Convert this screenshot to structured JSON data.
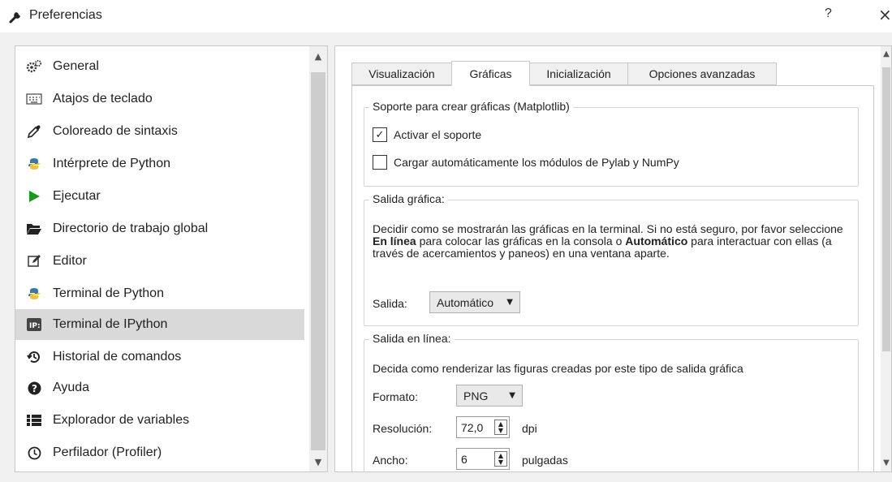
{
  "window": {
    "title": "Preferencias",
    "icon": "wrench-icon",
    "help_label": "?",
    "close_label": "×"
  },
  "sidebar": {
    "items": [
      {
        "label": "General",
        "icon": "gears-icon"
      },
      {
        "label": "Atajos de teclado",
        "icon": "keyboard-icon"
      },
      {
        "label": "Coloreado de sintaxis",
        "icon": "eyedropper-icon"
      },
      {
        "label": "Intérprete de Python",
        "icon": "python-icon"
      },
      {
        "label": "Ejecutar",
        "icon": "play-icon"
      },
      {
        "label": "Directorio de trabajo global",
        "icon": "folder-icon"
      },
      {
        "label": "Editor",
        "icon": "edit-icon"
      },
      {
        "label": "Terminal de Python",
        "icon": "python-icon"
      },
      {
        "label": "Terminal de IPython",
        "icon": "ipython-icon"
      },
      {
        "label": "Historial de comandos",
        "icon": "history-icon"
      },
      {
        "label": "Ayuda",
        "icon": "question-circle-icon"
      },
      {
        "label": "Explorador de variables",
        "icon": "table-list-icon"
      },
      {
        "label": "Perfilador (Profiler)",
        "icon": "clock-icon"
      }
    ],
    "selected_index": 8
  },
  "tabs": [
    {
      "label": "Visualización"
    },
    {
      "label": "Gráficas"
    },
    {
      "label": "Inicialización"
    },
    {
      "label": "Opciones avanzadas"
    }
  ],
  "active_tab": "Gráficas",
  "support_group": {
    "title": "Soporte para crear gráficas (Matplotlib)",
    "activate_label": "Activar el soporte",
    "activate_checked": true,
    "autoload_label": "Cargar automáticamente los módulos de Pylab y NumPy",
    "autoload_checked": false
  },
  "output_group": {
    "title": "Salida gráfica:",
    "desc_1": "Decidir como se mostrarán las gráficas en la terminal. Si no está seguro, por favor seleccione ",
    "desc_bold_1": "En línea",
    "desc_2": " para colocar las gráficas en la consola o ",
    "desc_bold_2": "Automático",
    "desc_3": " para interactuar con ellas (a través de acercamientos y paneos) en una ventana aparte.",
    "output_label": "Salida:",
    "output_value": "Automático"
  },
  "inline_group": {
    "title": "Salida en línea:",
    "desc": "Decida como renderizar las figuras creadas por este tipo de salida gráfica",
    "format_label": "Formato:",
    "format_value": "PNG",
    "resolution_label": "Resolución:",
    "resolution_value": "72,0",
    "resolution_unit": "dpi",
    "width_label": "Ancho:",
    "width_value": "6",
    "width_unit": "pulgadas"
  }
}
